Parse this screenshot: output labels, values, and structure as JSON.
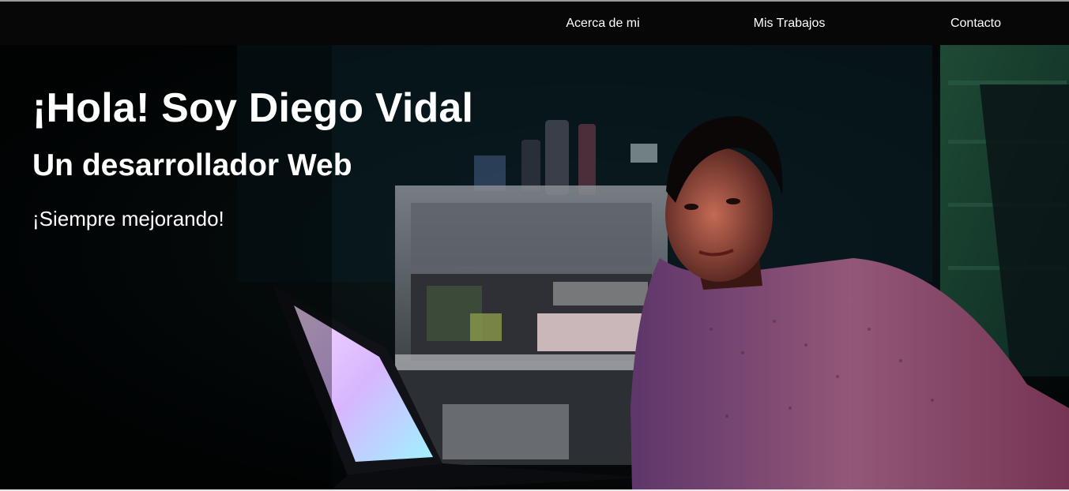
{
  "nav": {
    "items": [
      {
        "label": "Acerca de mi"
      },
      {
        "label": "Mis Trabajos"
      },
      {
        "label": "Contacto"
      }
    ]
  },
  "hero": {
    "title": "¡Hola! Soy Diego Vidal",
    "subtitle": "Un desarrollador Web",
    "tagline": "¡Siempre mejorando!",
    "photo": "hero-photo-person-with-laptop"
  },
  "colors": {
    "navbar_bg": "#070707",
    "hero_bg": "#03080a",
    "text": "#ffffff"
  }
}
